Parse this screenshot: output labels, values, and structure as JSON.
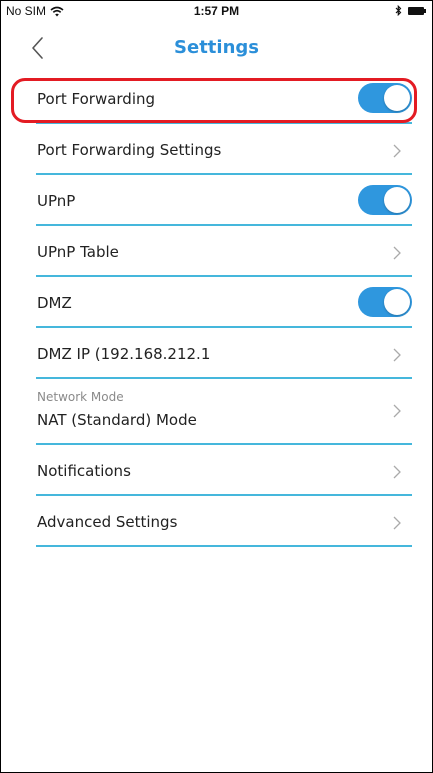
{
  "status_bar": {
    "carrier": "No SIM",
    "time": "1:57 PM"
  },
  "nav": {
    "title": "Settings"
  },
  "rows": [
    {
      "label": "Port Forwarding",
      "toggle_on": true
    },
    {
      "label": "Port Forwarding Settings"
    },
    {
      "label": "UPnP",
      "toggle_on": true
    },
    {
      "label": "UPnP Table"
    },
    {
      "label": "DMZ",
      "toggle_on": true
    },
    {
      "label": "DMZ IP (192.168.212.1"
    },
    {
      "sublabel": "Network Mode",
      "label": "NAT (Standard) Mode"
    },
    {
      "label": "Notifications"
    },
    {
      "label": "Advanced Settings"
    }
  ],
  "colors": {
    "accent": "#2b8fd9",
    "divider": "#45b7dc",
    "toggle_on": "#2f97de",
    "highlight": "#e31b23"
  }
}
